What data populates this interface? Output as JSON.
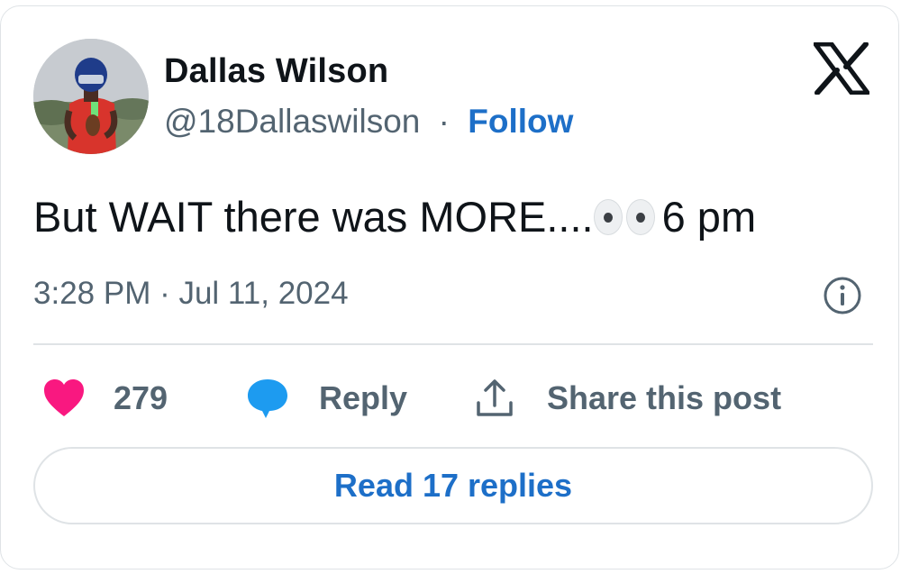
{
  "author": {
    "name": "Dallas Wilson",
    "handle": "@18Dallaswilson",
    "separator": "·",
    "follow_label": "Follow"
  },
  "tweet": {
    "text_before": "But WAIT there was MORE....",
    "emoji": "eyes",
    "text_after": "6 pm",
    "timestamp": "3:28 PM · Jul 11, 2024"
  },
  "actions": {
    "like_count": "279",
    "reply_label": "Reply",
    "share_label": "Share this post"
  },
  "read_replies_label": "Read 17 replies",
  "colors": {
    "link_blue": "#1d6fc8",
    "heart_pink": "#f91880",
    "reply_blue": "#1d9bf0",
    "muted_text": "#536471",
    "text": "#0f1419",
    "border": "#dfe3e6"
  },
  "icons": [
    "x-logo-icon",
    "info-icon",
    "heart-icon",
    "reply-bubble-icon",
    "share-icon"
  ]
}
